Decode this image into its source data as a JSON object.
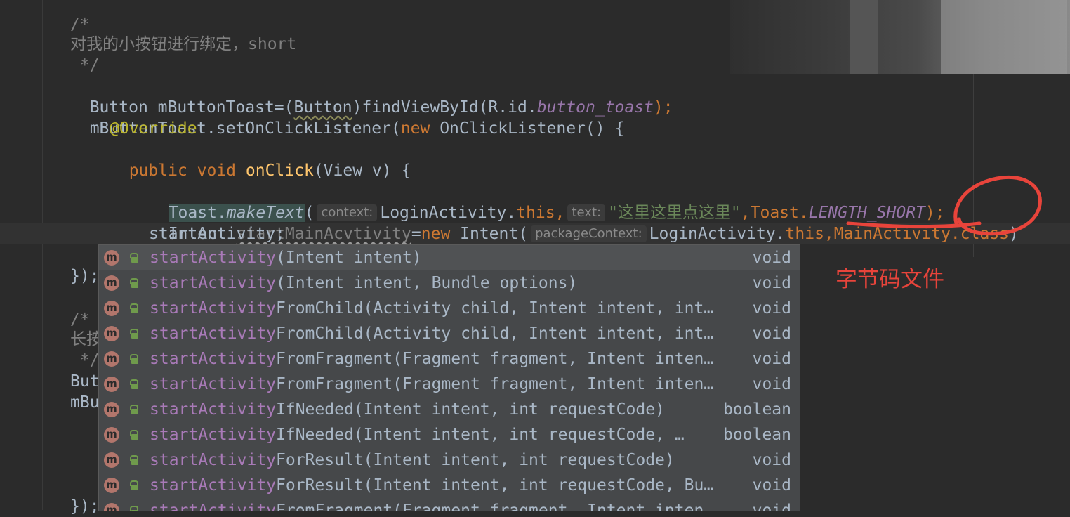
{
  "colors": {
    "background": "#2b2b2b",
    "comment": "#808080",
    "keyword": "#cc7832",
    "field": "#9876aa",
    "method": "#ffc66d",
    "annotation": "#bbb529",
    "string": "#6a8759",
    "popup_bg": "#46484a",
    "popup_match": "#a97ab8",
    "red_mark": "#e8443b"
  },
  "code": {
    "l1": "/*",
    "l2": "对我的小按钮进行绑定，short",
    "l3": " */",
    "l4": {
      "a": "Button mButtonToast=(",
      "b": "Button",
      "c": ")findViewById(R.id.",
      "d": "button_toast",
      "e": ");"
    },
    "l5": {
      "a": "mButtonToast.setOnClickListener(",
      "b": "new",
      "c": " OnClickListener() {"
    },
    "l6": "@Override",
    "l7": {
      "a": "public void",
      "b": " ",
      "c": "onClick",
      "d": "(View v) {"
    },
    "l8": {
      "a": "Toast.",
      "b": "makeText",
      "c": "(",
      "hint1": "context:",
      "d": "LoginActivity.",
      "e": "this",
      "f": ",",
      "hint2": "text:",
      "g": "\"这里这里点这里\"",
      "h": ",Toast.",
      "i": "LENGTH_SHORT",
      "j": ");"
    },
    "l9": {
      "a": "Intent ",
      "b": "startMainAcvtivity",
      "c": "=",
      "d": "new",
      "e": " Intent(",
      "hint1": "packageContext:",
      "f": "LoginActivity.",
      "g": "this",
      "h": ",MainActivity.",
      "i": "class",
      "j": ")"
    },
    "l10": "startActivity;",
    "stub1": "});",
    "stub2": "/*",
    "stub3": "长按",
    "stub4": " */",
    "stub5": "But",
    "stub6": "mBu",
    "stub7": "});"
  },
  "completion": {
    "icon_letter": "m",
    "items": [
      {
        "match": "startActivity",
        "rest": "(Intent intent)",
        "ret": "void"
      },
      {
        "match": "startActivity",
        "rest": "(Intent intent, Bundle options)",
        "ret": "void"
      },
      {
        "match": "startActivity",
        "rest": "FromChild(Activity child, Intent intent, int…",
        "ret": "void"
      },
      {
        "match": "startActivity",
        "rest": "FromChild(Activity child, Intent intent, int…",
        "ret": "void"
      },
      {
        "match": "startActivity",
        "rest": "FromFragment(Fragment fragment, Intent inten…",
        "ret": "void"
      },
      {
        "match": "startActivity",
        "rest": "FromFragment(Fragment fragment, Intent inten…",
        "ret": "void"
      },
      {
        "match": "startActivity",
        "rest": "IfNeeded(Intent intent, int requestCode)",
        "ret": "boolean"
      },
      {
        "match": "startActivity",
        "rest": "IfNeeded(Intent intent, int requestCode, …",
        "ret": "boolean"
      },
      {
        "match": "startActivity",
        "rest": "ForResult(Intent intent, int requestCode)",
        "ret": "void"
      },
      {
        "match": "startActivity",
        "rest": "ForResult(Intent intent, int requestCode, Bu…",
        "ret": "void"
      },
      {
        "match": "startActivity",
        "rest": "FromFragment(Fragment fragment, Intent inten…",
        "ret": "void"
      }
    ]
  },
  "annotation": {
    "text": "字节码文件"
  }
}
